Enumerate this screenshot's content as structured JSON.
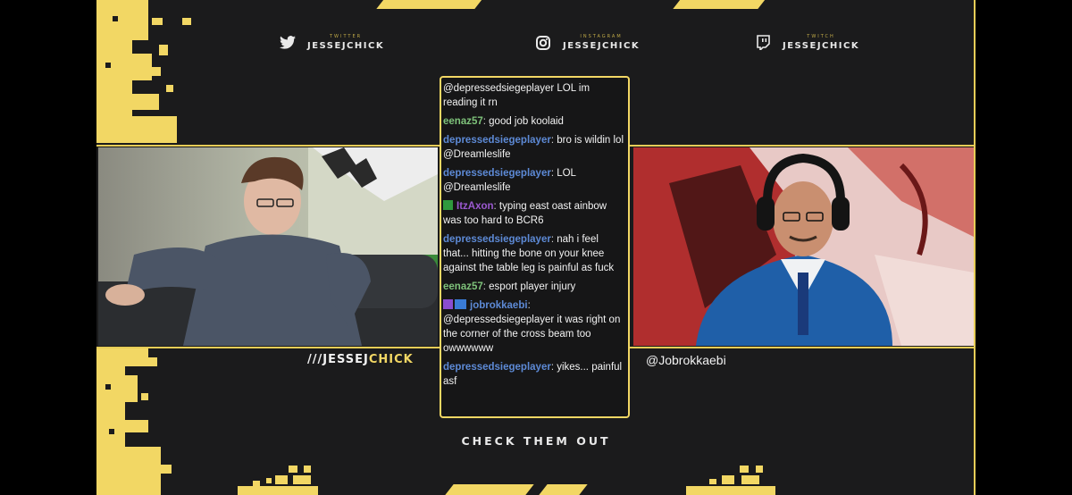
{
  "socials": [
    {
      "label": "TWITTER",
      "handle": "JESSEJCHICK",
      "icon": "twitter-bird-icon"
    },
    {
      "label": "INSTAGRAM",
      "handle": "JESSEJCHICK",
      "icon": "instagram-camera-icon"
    },
    {
      "label": "TWITCH",
      "handle": "JESSEJCHICK",
      "icon": "twitch-glitch-icon"
    }
  ],
  "left_cam": {
    "tag_prefix": "///JESSEJ",
    "tag_accent": "CHICK"
  },
  "right_cam": {
    "tag": "@Jobrokkaebi"
  },
  "chat": {
    "messages": [
      {
        "user": "",
        "color": "#f2f2f2",
        "text": "@depressedsiegeplayer LOL im reading it rn"
      },
      {
        "user": "eenaz57",
        "color": "#7ec27a",
        "text": "good job koolaid"
      },
      {
        "user": "depressedsiegeplayer",
        "color": "#5d8ad6",
        "text": "bro is wildin lol @Dreamleslife"
      },
      {
        "user": "depressedsiegeplayer",
        "color": "#5d8ad6",
        "text": "LOL @Dreamleslife"
      },
      {
        "user": "ItzAxon",
        "color": "#9b59d0",
        "text": "typing east oast ainbow was too hard to BCR6",
        "badge": "green"
      },
      {
        "user": "depressedsiegeplayer",
        "color": "#5d8ad6",
        "text": "nah i feel that... hitting the bone on your knee against the table leg is painful as fuck"
      },
      {
        "user": "eenaz57",
        "color": "#7ec27a",
        "text": "esport player injury"
      },
      {
        "user": "jobrokkaebi",
        "color": "#5d8ad6",
        "text": "@depressedsiegeplayer it was right on the corner of the cross beam too owwwwww",
        "badge": "purple-blue",
        "newline": true
      },
      {
        "user": "depressedsiegeplayer",
        "color": "#5d8ad6",
        "text": "yikes... painful asf"
      }
    ]
  },
  "cta": "CHECK THEM OUT",
  "colors": {
    "accent": "#f2d764",
    "background": "#1b1b1c",
    "frame": "#e7cd57"
  }
}
